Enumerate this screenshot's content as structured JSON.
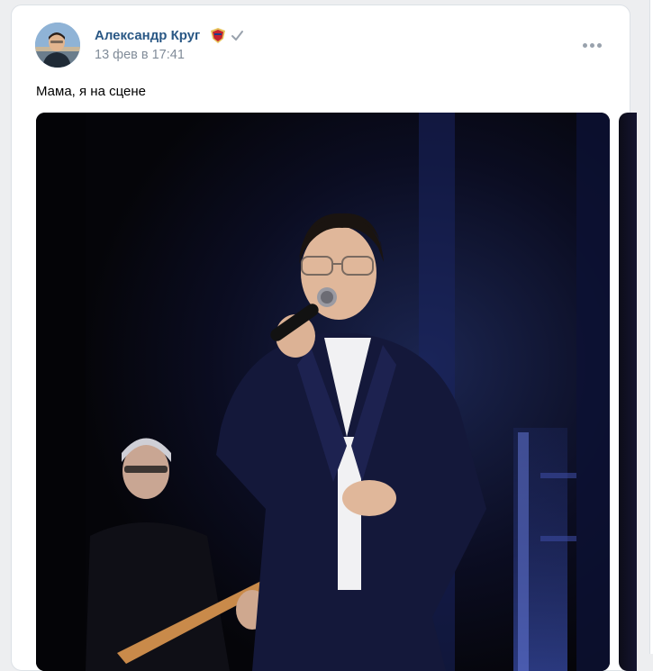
{
  "post": {
    "author_name": "Александр Круг",
    "timestamp": "13 фев в 17:41",
    "text": "Мама, я на сцене",
    "author_badge_icon": "team-emblem-icon",
    "verified_icon": "checkmark-icon",
    "more_icon": "more-dots-icon",
    "photo_subject": "concert-photo"
  },
  "colors": {
    "author_link": "#2a5885",
    "secondary_text": "#818c99",
    "page_background": "#edeef0",
    "card_background": "#ffffff",
    "icon_gray": "#99a2ad"
  }
}
